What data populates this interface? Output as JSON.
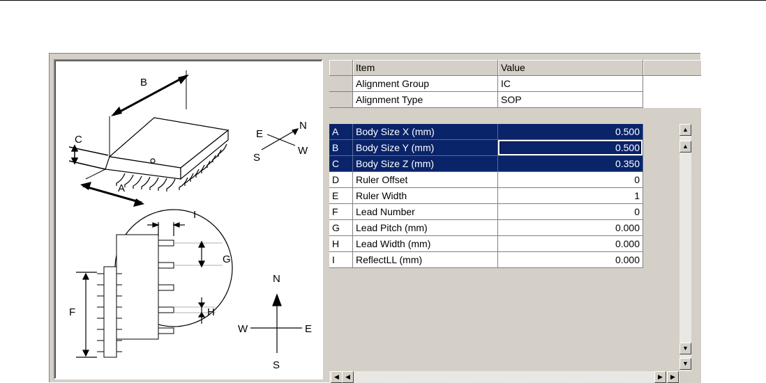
{
  "diagram": {
    "labels": {
      "a": "A",
      "b": "B",
      "c": "C",
      "f": "F",
      "g": "G",
      "h": "H",
      "i": "I"
    },
    "compass_top": {
      "n": "N",
      "e": "E",
      "s": "S",
      "w": "W"
    },
    "compass_bottom": {
      "n": "N",
      "e": "E",
      "s": "S",
      "w": "W"
    }
  },
  "grid": {
    "headers": {
      "item": "Item",
      "value": "Value"
    },
    "fixed_rows": [
      {
        "item": "Alignment Group",
        "value": "IC"
      },
      {
        "item": "Alignment Type",
        "value": "SOP"
      }
    ],
    "rows": [
      {
        "idx": "A",
        "item": "Body Size X (mm)",
        "value": "0.500",
        "selected": true
      },
      {
        "idx": "B",
        "item": "Body Size Y (mm)",
        "value": "0.500",
        "selected": true,
        "focused": true
      },
      {
        "idx": "C",
        "item": "Body Size Z (mm)",
        "value": "0.350",
        "selected": true
      },
      {
        "idx": "D",
        "item": "Ruler Offset",
        "value": "0"
      },
      {
        "idx": "E",
        "item": "Ruler Width",
        "value": "1"
      },
      {
        "idx": "F",
        "item": "Lead Number",
        "value": "0"
      },
      {
        "idx": "G",
        "item": "Lead Pitch (mm)",
        "value": "0.000"
      },
      {
        "idx": "H",
        "item": "Lead Width (mm)",
        "value": "0.000"
      },
      {
        "idx": "I",
        "item": "ReflectLL (mm)",
        "value": "0.000"
      }
    ]
  },
  "icons": {
    "scroll_top": "double-up-arrow-icon",
    "scroll_up": "up-arrow-icon",
    "scroll_down": "down-arrow-icon",
    "scroll_bottom": "double-down-arrow-icon",
    "scroll_first": "double-left-arrow-icon",
    "scroll_left": "left-arrow-icon",
    "scroll_right": "right-arrow-icon",
    "scroll_last": "double-right-arrow-icon"
  },
  "colors": {
    "selection": "#0a246a",
    "panel": "#d4d0c8"
  }
}
